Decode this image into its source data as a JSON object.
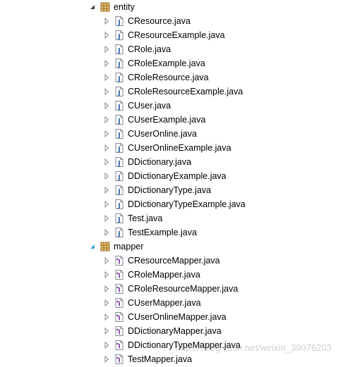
{
  "tree": [
    {
      "kind": "package",
      "label": "entity",
      "expanded": true,
      "icon": "package-icon"
    },
    {
      "kind": "class",
      "label": "CResource.java"
    },
    {
      "kind": "class",
      "label": "CResourceExample.java"
    },
    {
      "kind": "class",
      "label": "CRole.java"
    },
    {
      "kind": "class",
      "label": "CRoleExample.java"
    },
    {
      "kind": "class",
      "label": "CRoleResource.java"
    },
    {
      "kind": "class",
      "label": "CRoleResourceExample.java"
    },
    {
      "kind": "class",
      "label": "CUser.java"
    },
    {
      "kind": "class",
      "label": "CUserExample.java"
    },
    {
      "kind": "class",
      "label": "CUserOnline.java"
    },
    {
      "kind": "class",
      "label": "CUserOnlineExample.java"
    },
    {
      "kind": "class",
      "label": "DDictionary.java"
    },
    {
      "kind": "class",
      "label": "DDictionaryExample.java"
    },
    {
      "kind": "class",
      "label": "DDictionaryType.java"
    },
    {
      "kind": "class",
      "label": "DDictionaryTypeExample.java"
    },
    {
      "kind": "class",
      "label": "Test.java"
    },
    {
      "kind": "class",
      "label": "TestExample.java"
    },
    {
      "kind": "package",
      "label": "mapper",
      "expanded": true,
      "icon": "package-icon"
    },
    {
      "kind": "interface",
      "label": "CResourceMapper.java"
    },
    {
      "kind": "interface",
      "label": "CRoleMapper.java"
    },
    {
      "kind": "interface",
      "label": "CRoleResourceMapper.java"
    },
    {
      "kind": "interface",
      "label": "CUserMapper.java"
    },
    {
      "kind": "interface",
      "label": "CUserOnlineMapper.java"
    },
    {
      "kind": "interface",
      "label": "DDictionaryMapper.java"
    },
    {
      "kind": "interface",
      "label": "DDictionaryTypeMapper.java"
    },
    {
      "kind": "interface",
      "label": "TestMapper.java"
    }
  ],
  "icons": {
    "package": "package-icon",
    "class": "java-file-icon",
    "interface": "java-interface-file-icon",
    "expanded": "triangle-expanded-icon",
    "collapsed": "triangle-collapsed-icon"
  },
  "watermark": "https://blog.csdn.net/weixin_39076203",
  "colors": {
    "background": "#ffffff",
    "package_icon": "#c28a2e",
    "java_icon_letter": "#2d5ea8",
    "interface_letter": "#7b3ea0",
    "twisty": "#808080",
    "twisty_expanded_second": "#3aa0d8"
  }
}
